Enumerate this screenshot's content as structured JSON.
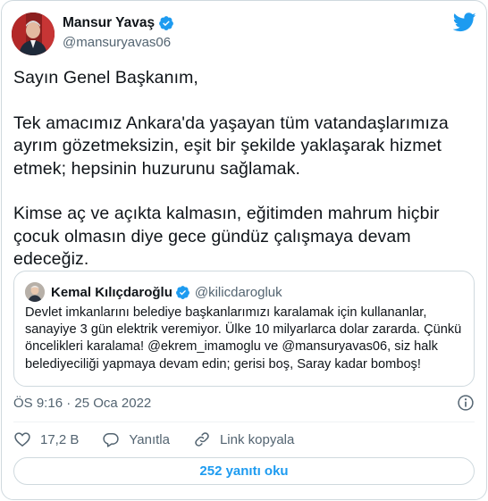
{
  "tweet": {
    "author_name": "Mansur Yavaş",
    "author_handle": "@mansuryavas06",
    "paragraphs": [
      "Sayın Genel Başkanım,",
      "Tek amacımız Ankara'da yaşayan tüm vatandaşlarımıza ayrım gözetmeksizin, eşit bir şekilde yaklaşarak hizmet etmek; hepsinin huzurunu sağlamak.",
      "Kimse aç ve açıkta kalmasın, eğitimden mahrum hiçbir çocuk olmasın diye gece gündüz çalışmaya devam edeceğiz."
    ],
    "timestamp": "ÖS 9:16 · 25 Oca 2022"
  },
  "quoted_tweet": {
    "author_name": "Kemal Kılıçdaroğlu",
    "author_handle": "@kilicdarogluk",
    "text": "Devlet imkanlarını belediye başkanlarımızı karalamak için kullananlar, sanayiye 3 gün elektrik veremiyor. Ülke 10 milyarlarca dolar zararda. Çünkü öncelikleri karalama! @ekrem_imamoglu ve @mansuryavas06, siz halk belediyeciliği yapmaya devam edin; gerisi boş, Saray kadar bomboş!"
  },
  "actions": {
    "like_count": "17,2 B",
    "reply_label": "Yanıtla",
    "copy_link_label": "Link kopyala"
  },
  "replies_button": "252 yanıtı oku",
  "colors": {
    "accent": "#1d9bf0",
    "secondary_text": "#536471",
    "border": "#cfd9de",
    "like": "#f91880",
    "share": "#00ba7c"
  },
  "icons": {
    "brand": "twitter-bird-icon",
    "verified": "verified-badge-icon",
    "info": "info-icon",
    "like": "heart-icon",
    "reply": "reply-bubble-icon",
    "copy_link": "link-icon"
  }
}
